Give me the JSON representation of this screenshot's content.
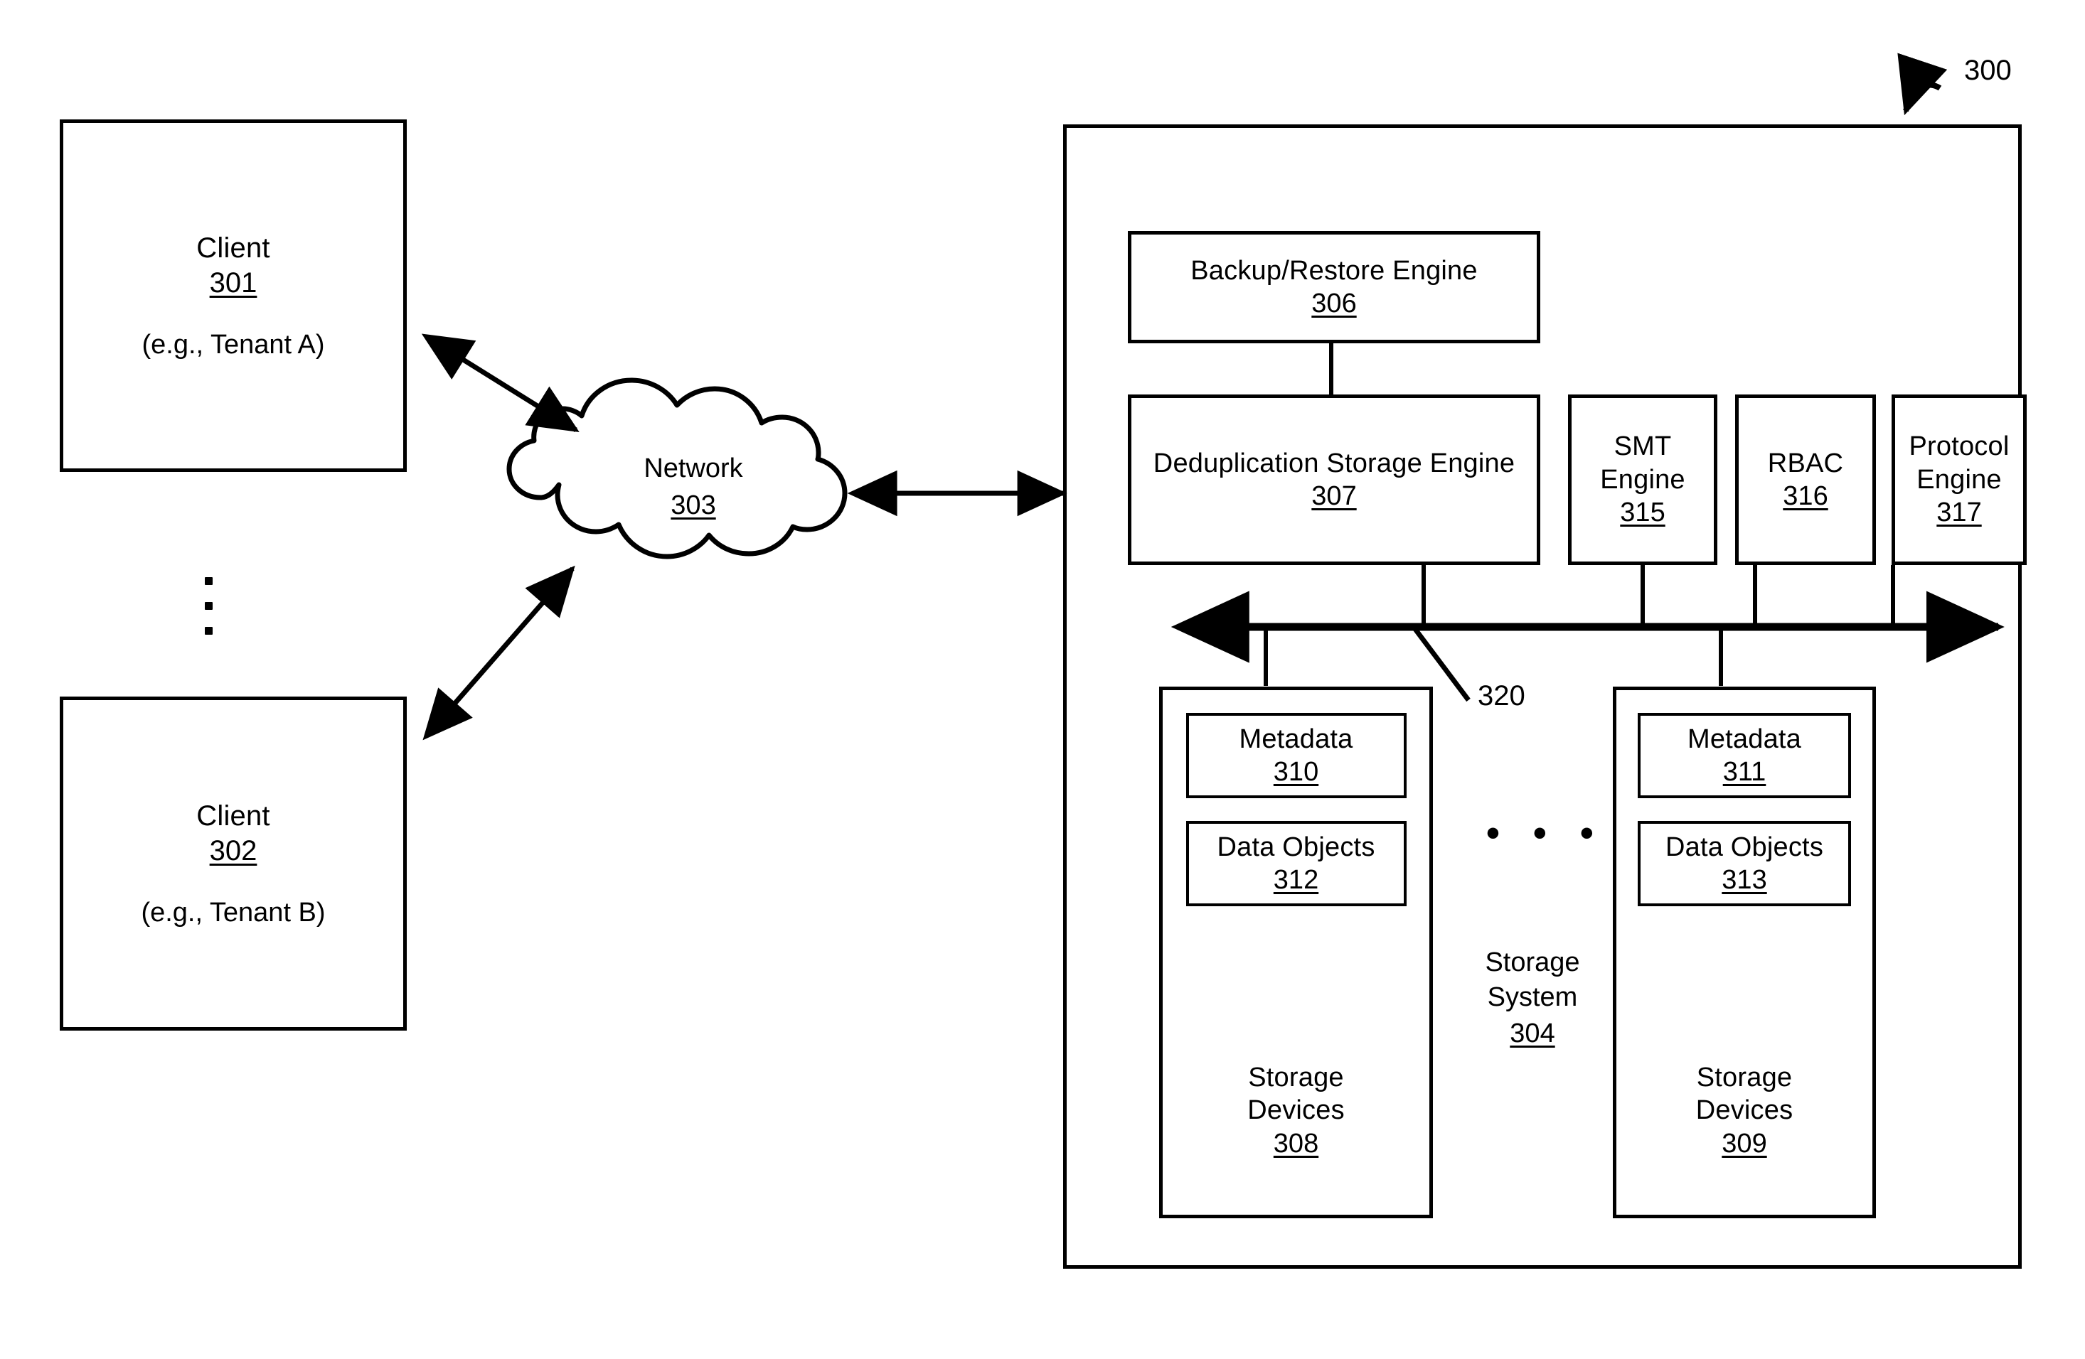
{
  "figure": {
    "reference": "300",
    "bus_reference": "320"
  },
  "clients": [
    {
      "name": "Client",
      "ref": "301",
      "tenant": "(e.g., Tenant A)"
    },
    {
      "name": "Client",
      "ref": "302",
      "tenant": "(e.g., Tenant B)"
    }
  ],
  "clients_ellipsis": "⋮",
  "network": {
    "name": "Network",
    "ref": "303"
  },
  "storage_system": {
    "name_line1": "Storage",
    "name_line2": "System",
    "ref": "304",
    "ellipsis": "• • •"
  },
  "engines": [
    {
      "name": "Backup/Restore Engine",
      "ref": "306"
    },
    {
      "name": "Deduplication Storage Engine",
      "ref": "307"
    },
    {
      "name_line1": "SMT",
      "name_line2": "Engine",
      "ref": "315"
    },
    {
      "name_line1": "RBAC",
      "name_line2": "",
      "ref": "316"
    },
    {
      "name_line1": "Protocol",
      "name_line2": "Engine",
      "ref": "317"
    }
  ],
  "storage_units": [
    {
      "metadata": {
        "name": "Metadata",
        "ref": "310"
      },
      "data_objects": {
        "name": "Data Objects",
        "ref": "312"
      },
      "devices": {
        "name_line1": "Storage",
        "name_line2": "Devices",
        "ref": "308"
      }
    },
    {
      "metadata": {
        "name": "Metadata",
        "ref": "311"
      },
      "data_objects": {
        "name": "Data Objects",
        "ref": "313"
      },
      "devices": {
        "name_line1": "Storage",
        "name_line2": "Devices",
        "ref": "309"
      }
    }
  ],
  "colors": {
    "line": "#000000",
    "background": "#ffffff"
  }
}
